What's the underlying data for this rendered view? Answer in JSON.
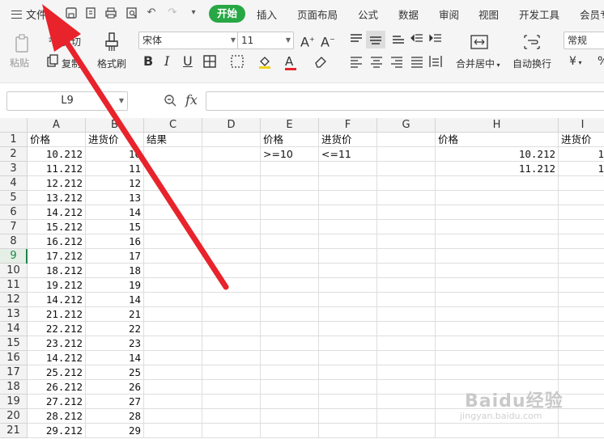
{
  "menu": {
    "file_label": "文件"
  },
  "tabs": [
    "开始",
    "插入",
    "页面布局",
    "公式",
    "数据",
    "审阅",
    "视图",
    "开发工具",
    "会员专"
  ],
  "toolbar": {
    "paste_label": "粘贴",
    "cut_label": "剪切",
    "copy_label": "复制",
    "format_painter_label": "格式刷",
    "font_name": "宋体",
    "font_size": "11",
    "merge_center_label": "合并居中",
    "wrap_text_label": "自动换行",
    "number_format": "常规",
    "currency_symbol": "¥"
  },
  "formula_bar": {
    "cell_ref": "L9",
    "fx_label": "fx",
    "formula": ""
  },
  "columns": [
    "A",
    "B",
    "C",
    "D",
    "E",
    "F",
    "G",
    "H",
    "I"
  ],
  "rows": [
    [
      "价格",
      "进货价",
      "结果",
      "",
      "价格",
      "进货价",
      "",
      "价格",
      "进货价"
    ],
    [
      "10.212",
      "10",
      "",
      "",
      ">=10",
      "<=11",
      "",
      "10.212",
      "1"
    ],
    [
      "11.212",
      "11",
      "",
      "",
      "",
      "",
      "",
      "11.212",
      "1"
    ],
    [
      "12.212",
      "12",
      "",
      "",
      "",
      "",
      "",
      "",
      ""
    ],
    [
      "13.212",
      "13",
      "",
      "",
      "",
      "",
      "",
      "",
      ""
    ],
    [
      "14.212",
      "14",
      "",
      "",
      "",
      "",
      "",
      "",
      ""
    ],
    [
      "15.212",
      "15",
      "",
      "",
      "",
      "",
      "",
      "",
      ""
    ],
    [
      "16.212",
      "16",
      "",
      "",
      "",
      "",
      "",
      "",
      ""
    ],
    [
      "17.212",
      "17",
      "",
      "",
      "",
      "",
      "",
      "",
      ""
    ],
    [
      "18.212",
      "18",
      "",
      "",
      "",
      "",
      "",
      "",
      ""
    ],
    [
      "19.212",
      "19",
      "",
      "",
      "",
      "",
      "",
      "",
      ""
    ],
    [
      "14.212",
      "14",
      "",
      "",
      "",
      "",
      "",
      "",
      ""
    ],
    [
      "21.212",
      "21",
      "",
      "",
      "",
      "",
      "",
      "",
      ""
    ],
    [
      "22.212",
      "22",
      "",
      "",
      "",
      "",
      "",
      "",
      ""
    ],
    [
      "23.212",
      "23",
      "",
      "",
      "",
      "",
      "",
      "",
      ""
    ],
    [
      "14.212",
      "14",
      "",
      "",
      "",
      "",
      "",
      "",
      ""
    ],
    [
      "25.212",
      "25",
      "",
      "",
      "",
      "",
      "",
      "",
      ""
    ],
    [
      "26.212",
      "26",
      "",
      "",
      "",
      "",
      "",
      "",
      ""
    ],
    [
      "27.212",
      "27",
      "",
      "",
      "",
      "",
      "",
      "",
      ""
    ],
    [
      "28.212",
      "28",
      "",
      "",
      "",
      "",
      "",
      "",
      ""
    ],
    [
      "29.212",
      "29",
      "",
      "",
      "",
      "",
      "",
      "",
      ""
    ]
  ],
  "selected_row": 9,
  "watermark": {
    "main": "Baidu经验",
    "sub": "jingyan.baidu.com"
  },
  "colors": {
    "accent": "#28a745",
    "arrow": "#e8232b"
  }
}
